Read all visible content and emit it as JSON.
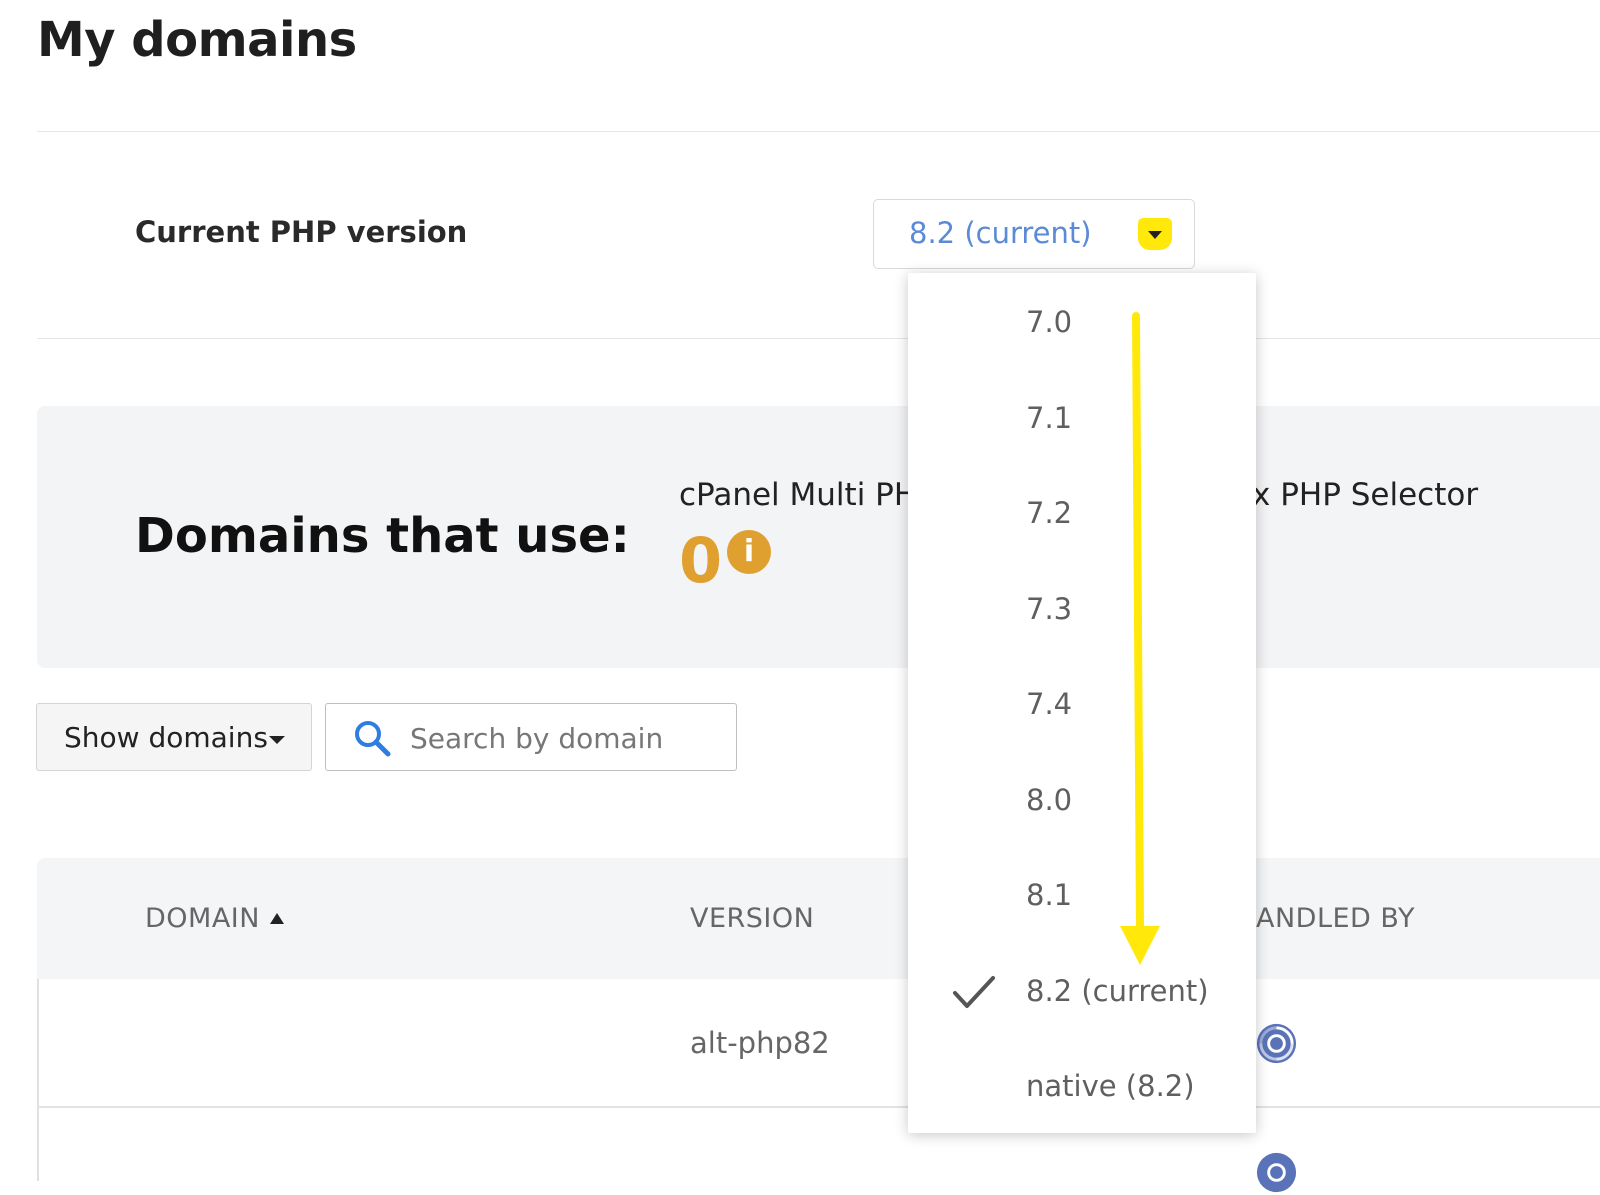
{
  "page": {
    "title": "My domains"
  },
  "php_version": {
    "label": "Current PHP version",
    "selected": "8.2 (current)",
    "options": [
      {
        "label": "7.0",
        "checked": false
      },
      {
        "label": "7.1",
        "checked": false
      },
      {
        "label": "7.2",
        "checked": false
      },
      {
        "label": "7.3",
        "checked": false
      },
      {
        "label": "7.4",
        "checked": false
      },
      {
        "label": "8.0",
        "checked": false
      },
      {
        "label": "8.1",
        "checked": false
      },
      {
        "label": "8.2 (current)",
        "checked": true
      },
      {
        "label": "native (8.2)",
        "checked": false
      }
    ]
  },
  "summary": {
    "title": "Domains that use:",
    "columns": [
      {
        "label": "cPanel Multi PH",
        "count": "0"
      },
      {
        "label": "x PHP Selector"
      }
    ]
  },
  "toolbar": {
    "show_domains_label": "Show domains",
    "search_placeholder": "Search by domain"
  },
  "table": {
    "headers": [
      "DOMAIN",
      "VERSION",
      "ANDLED BY"
    ],
    "sort": {
      "column": "DOMAIN",
      "direction": "asc"
    },
    "rows": [
      {
        "domain": "",
        "version": "alt-php82",
        "handled_by_icon": "cloudlinux-logo-icon"
      }
    ]
  },
  "colors": {
    "accent_blue": "#5b8ad6",
    "highlight_yellow": "#ffe80a",
    "count_orange": "#e0a030"
  },
  "icons": {
    "dropdown_arrow": "chevron-down-icon",
    "search": "search-icon",
    "info": "info-icon",
    "check": "checkmark-icon",
    "annotation": "arrow-down-icon"
  }
}
